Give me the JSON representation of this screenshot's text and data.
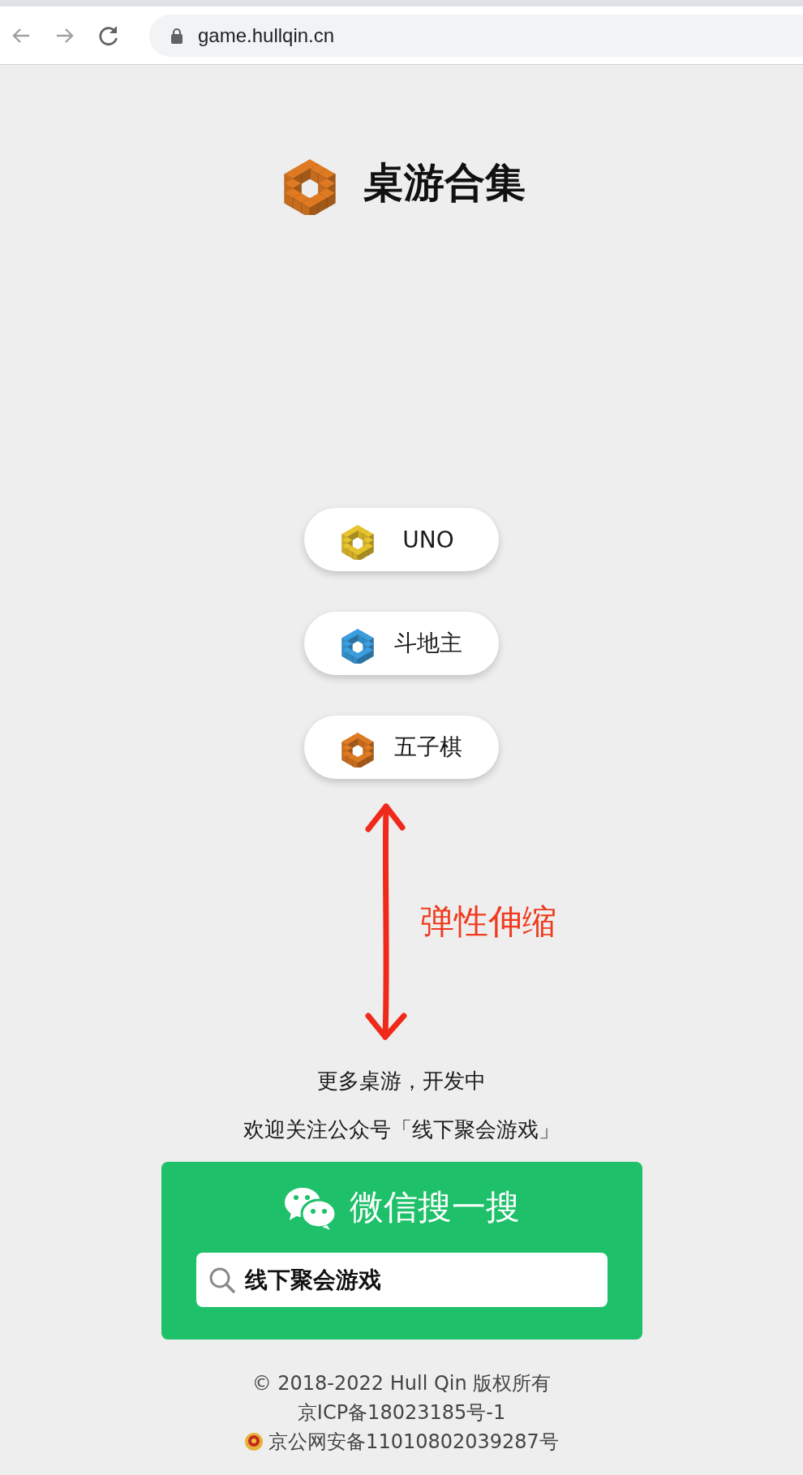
{
  "browser": {
    "url": "game.hullqin.cn"
  },
  "site": {
    "title": "桌游合集"
  },
  "games": [
    {
      "label": "UNO",
      "color": "#e8c42c"
    },
    {
      "label": "斗地主",
      "color": "#3a9ee0"
    },
    {
      "label": "五子棋",
      "color": "#e07a22"
    }
  ],
  "annotation": {
    "text": "弹性伸缩"
  },
  "notice": [
    "更多桌游，开发中",
    "欢迎关注公众号「线下聚会游戏」"
  ],
  "wechat": {
    "title": "微信搜一搜",
    "query": "线下聚会游戏"
  },
  "footer": {
    "copyright": "© 2018-2022 Hull Qin 版权所有",
    "icp": "京ICP备18023185号-1",
    "police": "京公网安备11010802039287号"
  }
}
